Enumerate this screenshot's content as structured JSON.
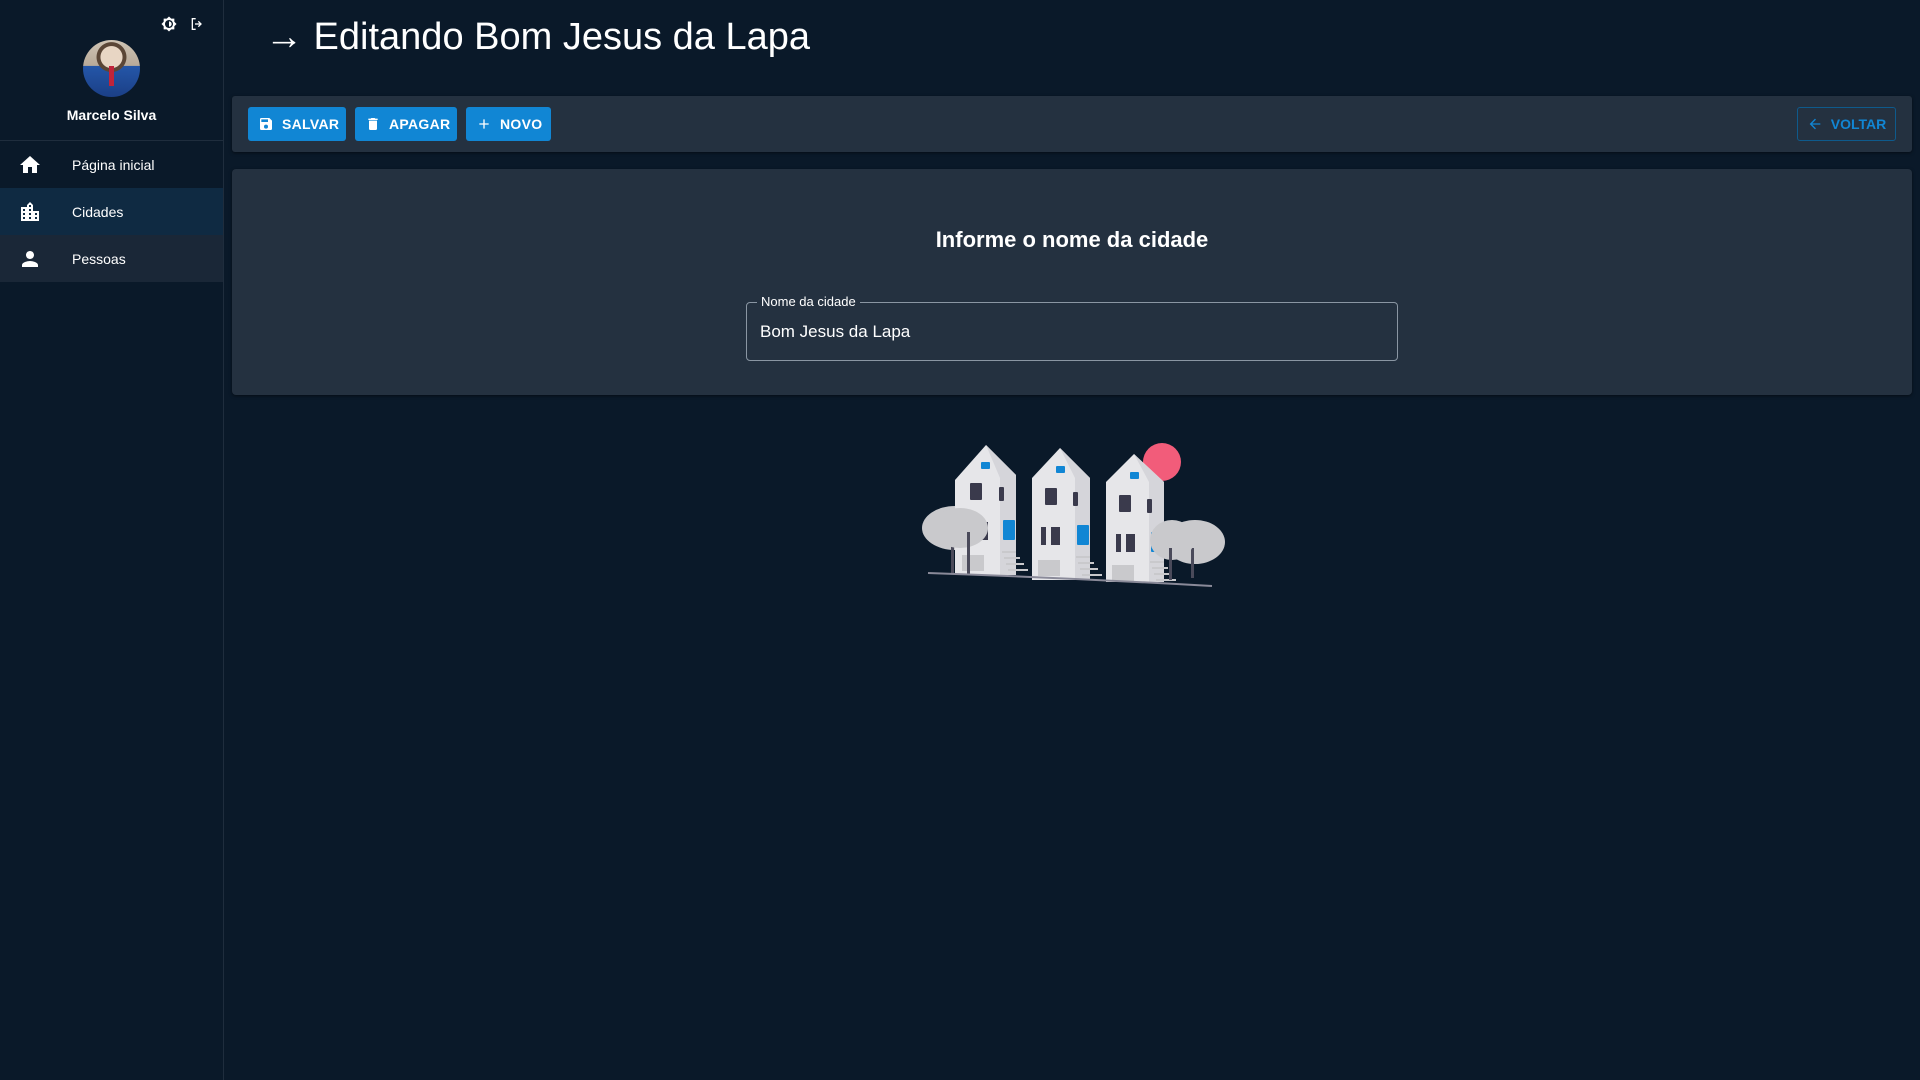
{
  "sidebar": {
    "user_name": "Marcelo Silva",
    "top_icons": [
      "theme-toggle-icon",
      "logout-icon"
    ],
    "items": [
      {
        "label": "Página inicial",
        "icon": "home-icon"
      },
      {
        "label": "Cidades",
        "icon": "city-icon",
        "active": true
      },
      {
        "label": "Pessoas",
        "icon": "person-icon"
      }
    ]
  },
  "header": {
    "title": "→ Editando Bom Jesus da Lapa"
  },
  "toolbar": {
    "save_label": "Salvar",
    "delete_label": "Apagar",
    "new_label": "Novo",
    "back_label": "Voltar"
  },
  "form": {
    "heading": "Informe o nome da cidade",
    "city_field_label": "Nome da cidade",
    "city_value": "Bom Jesus da Lapa"
  },
  "colors": {
    "background": "#0a1929",
    "panel": "#243140",
    "accent": "#1186d4",
    "active_item": "#0f2a42",
    "illustration_sun": "#f25c7a"
  }
}
